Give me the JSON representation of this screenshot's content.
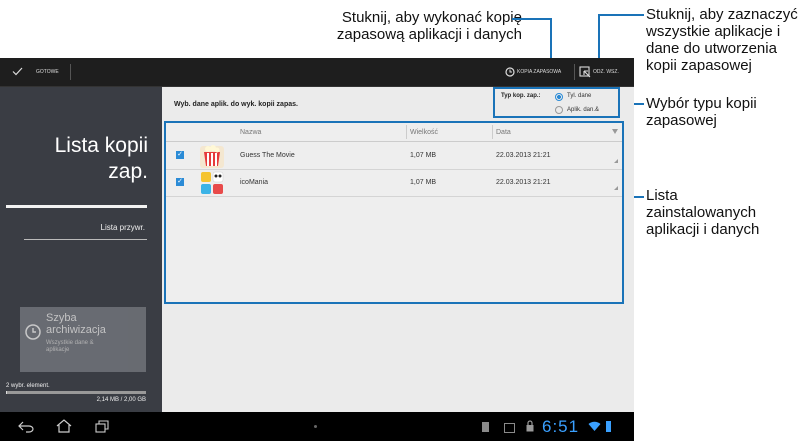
{
  "callouts": {
    "backup_line1": "Stuknij, aby wykonać kopię",
    "backup_line2": "zapasową aplikacji i danych",
    "selectall_line1": "Stuknij, aby zaznaczyć",
    "selectall_line2": "wszystkie aplikacje i",
    "selectall_line3": "dane do utworzenia",
    "selectall_line4": "kopii zapasowej",
    "type_line1": "Wybór typu kopii",
    "type_line2": "zapasowej",
    "list_line1": "Lista",
    "list_line2": "zainstalowanych",
    "list_line3": "aplikacji i danych"
  },
  "actionbar": {
    "done_label": "GOTOWE",
    "backup_label": "KOPIA ZAPASOWA",
    "selectall_label": "ODZ. WSZ."
  },
  "sidebar": {
    "title_line1": "Lista kopii",
    "title_line2": "zap.",
    "restore_label": "Lista przywr.",
    "quick_title_line1": "Szyba",
    "quick_title_line2": "archiwizacja",
    "quick_sub_line1": "Wszystkie dane &",
    "quick_sub_line2": "aplikacje",
    "selected_count": "2 wybr. element.",
    "storage": "2,14 MB / 2,00 GB"
  },
  "content": {
    "header_text": "Wyb. dane aplik. do wyk. kopii zapas.",
    "type_label": "Typ kop. zap.:",
    "type_option1": "Tyl. dane",
    "type_option2": "Aplik. dan.&",
    "columns": [
      "Nazwa",
      "Wielkość",
      "Data"
    ],
    "rows": [
      {
        "name": "Guess The Movie",
        "size": "1,07 MB",
        "date": "22.03.2013 21:21"
      },
      {
        "name": "icoMania",
        "size": "1,07 MB",
        "date": "22.03.2013 21:21"
      }
    ]
  },
  "statusbar": {
    "time": "6:51"
  },
  "colors": {
    "accent": "#1a73b8",
    "checkbox": "#2b8bd6",
    "time": "#3aa0ff"
  }
}
